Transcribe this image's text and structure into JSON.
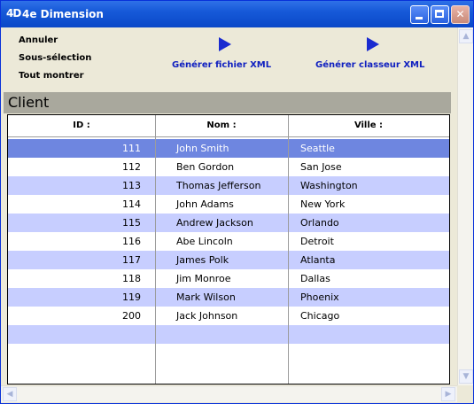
{
  "window": {
    "logo": "4D",
    "title": "4e Dimension"
  },
  "titlebar_buttons": {
    "close_glyph": "✕"
  },
  "menu": [
    "Annuler",
    "Sous-sélection",
    "Tout montrer"
  ],
  "actions": {
    "xml_file": "Générer fichier XML",
    "xml_workbook": "Générer classeur XML"
  },
  "section": {
    "title": "Client"
  },
  "table": {
    "columns": [
      "ID :",
      "Nom :",
      "Ville :"
    ],
    "selected_row": 0,
    "rows": [
      {
        "id": "111",
        "nom": "John Smith",
        "ville": "Seattle"
      },
      {
        "id": "112",
        "nom": "Ben Gordon",
        "ville": "San Jose"
      },
      {
        "id": "113",
        "nom": "Thomas Jefferson",
        "ville": "Washington"
      },
      {
        "id": "114",
        "nom": "John Adams",
        "ville": "New York"
      },
      {
        "id": "115",
        "nom": "Andrew Jackson",
        "ville": "Orlando"
      },
      {
        "id": "116",
        "nom": "Abe Lincoln",
        "ville": "Detroit"
      },
      {
        "id": "117",
        "nom": "James Polk",
        "ville": "Atlanta"
      },
      {
        "id": "118",
        "nom": "Jim Monroe",
        "ville": "Dallas"
      },
      {
        "id": "119",
        "nom": "Mark Wilson",
        "ville": "Phoenix"
      },
      {
        "id": "200",
        "nom": "Jack Johnson",
        "ville": "Chicago"
      }
    ]
  },
  "colors": {
    "title_bar": "#0a48c8",
    "selected_row": "#6e86e0",
    "alt_row": "#c7ceff",
    "action_text": "#1020c0",
    "section_bg": "#a9a89d"
  }
}
